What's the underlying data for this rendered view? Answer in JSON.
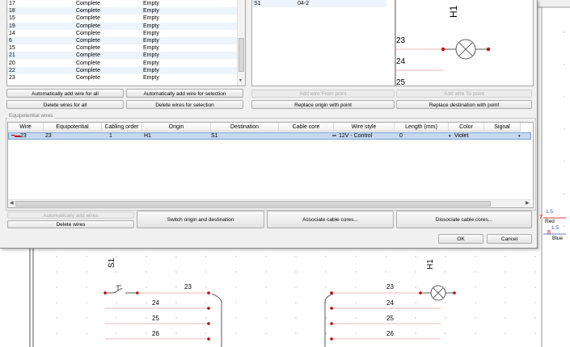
{
  "wire_list": {
    "rows": [
      {
        "id": "17",
        "status": "Complete",
        "type": "Empty"
      },
      {
        "id": "18",
        "status": "Complete",
        "type": "Empty"
      },
      {
        "id": "15",
        "status": "Complete",
        "type": "Empty"
      },
      {
        "id": "19",
        "status": "Complete",
        "type": "Empty"
      },
      {
        "id": "14",
        "status": "Complete",
        "type": "Empty"
      },
      {
        "id": "6",
        "status": "Complete",
        "type": "Empty"
      },
      {
        "id": "15",
        "status": "Complete",
        "type": "Empty"
      },
      {
        "id": "21",
        "status": "Complete",
        "type": "Empty"
      },
      {
        "id": "20",
        "status": "Complete",
        "type": "Empty"
      },
      {
        "id": "22",
        "status": "Complete",
        "type": "Empty"
      },
      {
        "id": "23",
        "status": "Complete",
        "type": "Empty"
      }
    ]
  },
  "buttons": {
    "auto_add_all": "Automatically add wire for all",
    "auto_add_selection": "Automatically add wire for selection",
    "delete_all": "Delete wires for all",
    "delete_selection": "Delete wires for selection",
    "add_from_point": "Add wire From point",
    "add_to_point": "Add wire To point",
    "replace_origin": "Replace origin with point",
    "replace_destination": "Replace destination with point",
    "auto_add_wires": "Automatically add wires",
    "delete_wires": "Delete wires",
    "switch": "Switch origin and destination",
    "associate": "Associate cable cores...",
    "dissociate": "Dissociate cable cores...",
    "ok": "OK",
    "cancel": "Cancel"
  },
  "mapping": {
    "origin": "S1",
    "pin": "04-2"
  },
  "schematic_preview": {
    "component": "H1",
    "wires": [
      "23",
      "24",
      "25"
    ]
  },
  "equipotential": {
    "group_title": "Equipotential wires",
    "columns": [
      "Wire",
      "Equipotential",
      "Cabling order",
      "Origin",
      "Destination",
      "Cable core",
      "Wire style",
      "Length (mm)",
      "Color",
      "Signal"
    ],
    "row": {
      "wire": "23",
      "equipotential": "23",
      "cabling_order": "1",
      "origin": "H1",
      "destination": "S1",
      "cable_core": "",
      "wire_style": "12V - Control",
      "length": "0",
      "color": "Violet",
      "signal": ""
    }
  },
  "background": {
    "left_component": "S1",
    "right_component": "H1",
    "wires": [
      "23",
      "24",
      "25",
      "26"
    ],
    "right_panel": {
      "section1": "1.5",
      "num1": "7",
      "color1": "Red",
      "num2": "8",
      "section2": "1.5",
      "color2": "Blue"
    }
  },
  "colors": {
    "accent": "#c00000",
    "wire_line": "#e8a0a8",
    "selection": "#c5d9f1"
  }
}
